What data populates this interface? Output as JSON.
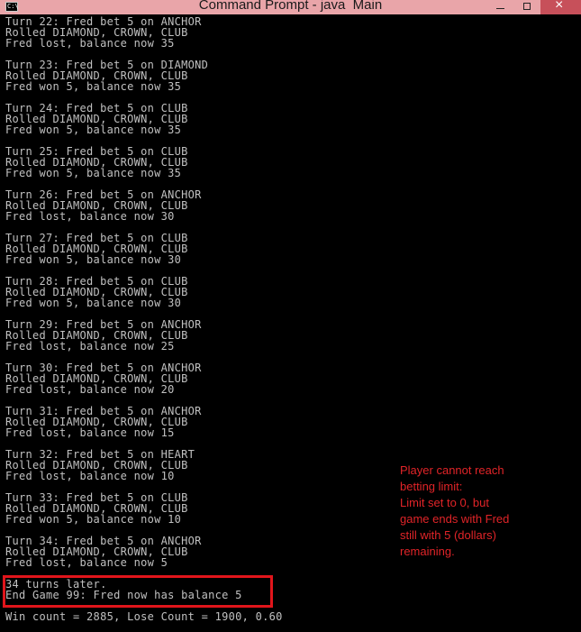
{
  "window": {
    "title": "Command Prompt - java  Main",
    "icon_label": "C:\\"
  },
  "console": {
    "turns": [
      {
        "bet": "Turn 22: Fred bet 5 on ANCHOR",
        "rolled": "Rolled DIAMOND, CROWN, CLUB",
        "result": "Fred lost, balance now 35"
      },
      {
        "bet": "Turn 23: Fred bet 5 on DIAMOND",
        "rolled": "Rolled DIAMOND, CROWN, CLUB",
        "result": "Fred won 5, balance now 35"
      },
      {
        "bet": "Turn 24: Fred bet 5 on CLUB",
        "rolled": "Rolled DIAMOND, CROWN, CLUB",
        "result": "Fred won 5, balance now 35"
      },
      {
        "bet": "Turn 25: Fred bet 5 on CLUB",
        "rolled": "Rolled DIAMOND, CROWN, CLUB",
        "result": "Fred won 5, balance now 35"
      },
      {
        "bet": "Turn 26: Fred bet 5 on ANCHOR",
        "rolled": "Rolled DIAMOND, CROWN, CLUB",
        "result": "Fred lost, balance now 30"
      },
      {
        "bet": "Turn 27: Fred bet 5 on CLUB",
        "rolled": "Rolled DIAMOND, CROWN, CLUB",
        "result": "Fred won 5, balance now 30"
      },
      {
        "bet": "Turn 28: Fred bet 5 on CLUB",
        "rolled": "Rolled DIAMOND, CROWN, CLUB",
        "result": "Fred won 5, balance now 30"
      },
      {
        "bet": "Turn 29: Fred bet 5 on ANCHOR",
        "rolled": "Rolled DIAMOND, CROWN, CLUB",
        "result": "Fred lost, balance now 25"
      },
      {
        "bet": "Turn 30: Fred bet 5 on ANCHOR",
        "rolled": "Rolled DIAMOND, CROWN, CLUB",
        "result": "Fred lost, balance now 20"
      },
      {
        "bet": "Turn 31: Fred bet 5 on ANCHOR",
        "rolled": "Rolled DIAMOND, CROWN, CLUB",
        "result": "Fred lost, balance now 15"
      },
      {
        "bet": "Turn 32: Fred bet 5 on HEART",
        "rolled": "Rolled DIAMOND, CROWN, CLUB",
        "result": "Fred lost, balance now 10"
      },
      {
        "bet": "Turn 33: Fred bet 5 on CLUB",
        "rolled": "Rolled DIAMOND, CROWN, CLUB",
        "result": "Fred won 5, balance now 10"
      },
      {
        "bet": "Turn 34: Fred bet 5 on ANCHOR",
        "rolled": "Rolled DIAMOND, CROWN, CLUB",
        "result": "Fred lost, balance now 5"
      }
    ],
    "turns_later": "34 turns later.",
    "end_game": "End Game 99: Fred now has balance 5",
    "win_count": "Win count = 2885, Lose Count = 1900, 0.60"
  },
  "annotation": {
    "text": "Player cannot reach\nbetting limit:\nLimit set to 0, but\ngame ends with Fred\nstill with 5 (dollars)\nremaining.",
    "color": "#e12428"
  },
  "highlight": {
    "border_color": "#e0151b"
  }
}
